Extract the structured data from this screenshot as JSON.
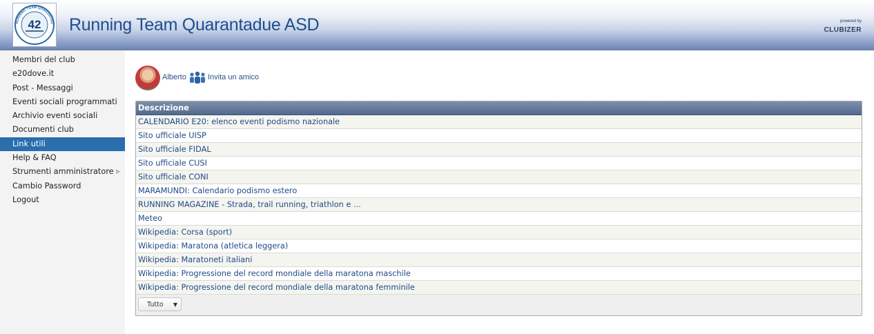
{
  "header": {
    "title": "Running Team Quarantadue ASD",
    "logo": {
      "icon": "team-42-logo-icon",
      "number": "42",
      "ring_text": "RUNNING TEAM QUARANTADUE"
    },
    "powered_by": {
      "small": "powered by",
      "brand": "CLUBIZER"
    }
  },
  "sidebar": {
    "items": [
      {
        "label": "Membri del club"
      },
      {
        "label": "e20dove.it"
      },
      {
        "label": "Post - Messaggi"
      },
      {
        "label": "Eventi sociali programmati"
      },
      {
        "label": "Archivio eventi sociali"
      },
      {
        "label": "Documenti club"
      },
      {
        "label": "Link utili",
        "active": true
      },
      {
        "label": "Help & FAQ"
      },
      {
        "label": "Strumenti amministratore",
        "chevron": "chevron-right-icon"
      },
      {
        "label": "Cambio Password"
      },
      {
        "label": "Logout"
      }
    ]
  },
  "user": {
    "name": "Alberto",
    "invite_label": "Invita un amico",
    "invite_icon": "group-people-icon"
  },
  "table": {
    "header": "Descrizione",
    "rows": [
      "CALENDARIO E20: elenco eventi podismo nazionale",
      "Sito ufficiale UISP",
      "Sito ufficiale FIDAL",
      "Sito ufficiale CUSI",
      "Sito ufficiale CONI",
      "MARAMUNDI: Calendario podismo estero",
      "RUNNING MAGAZINE - Strada, trail running, triathlon e ...",
      "Meteo",
      "Wikipedia: Corsa (sport)",
      "Wikipedia: Maratona (atletica leggera)",
      "Wikipedia: Maratoneti italiani",
      "Wikipedia: Progressione del record mondiale della maratona maschile",
      "Wikipedia: Progressione del record mondiale della maratona femminile"
    ],
    "filter": {
      "selected": "Tutto"
    }
  },
  "colors": {
    "accent": "#2b6ead",
    "link": "#1f4a86",
    "header_bar": "#52698e"
  }
}
